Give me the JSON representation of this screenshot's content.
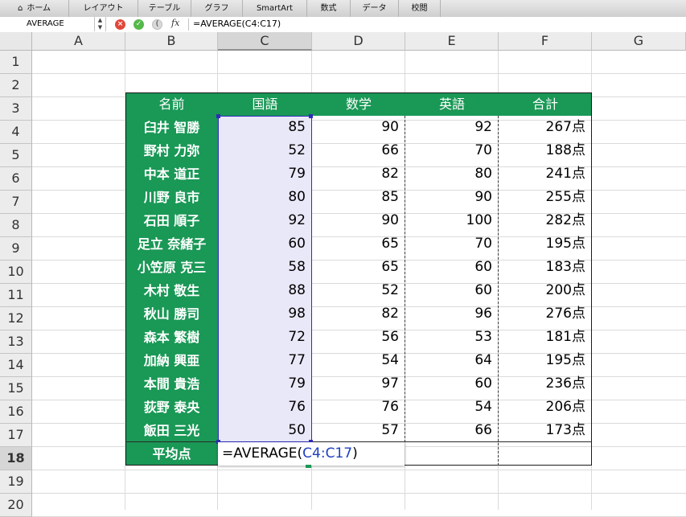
{
  "ribbon": {
    "tabs": [
      "ホーム",
      "レイアウト",
      "テーブル",
      "グラフ",
      "SmartArt",
      "数式",
      "データ",
      "校閲"
    ]
  },
  "formula_bar": {
    "name_box": "AVERAGE",
    "fx_label": "fx",
    "formula": "=AVERAGE(C4:C17)"
  },
  "sheet": {
    "columns": [
      "A",
      "B",
      "C",
      "D",
      "E",
      "F",
      "G"
    ],
    "selected_column": "C",
    "rows": [
      "1",
      "2",
      "3",
      "4",
      "5",
      "6",
      "7",
      "8",
      "9",
      "10",
      "11",
      "12",
      "13",
      "14",
      "15",
      "16",
      "17",
      "18",
      "19",
      "20"
    ],
    "selected_row": "18",
    "table_header": [
      "名前",
      "国語",
      "数学",
      "英語",
      "合計"
    ],
    "table_rows": [
      {
        "name": "臼井 智勝",
        "kokugo": "85",
        "sugaku": "90",
        "eigo": "92",
        "total": "267点"
      },
      {
        "name": "野村 力弥",
        "kokugo": "52",
        "sugaku": "66",
        "eigo": "70",
        "total": "188点"
      },
      {
        "name": "中本 道正",
        "kokugo": "79",
        "sugaku": "82",
        "eigo": "80",
        "total": "241点"
      },
      {
        "name": "川野 良市",
        "kokugo": "80",
        "sugaku": "85",
        "eigo": "90",
        "total": "255点"
      },
      {
        "name": "石田 順子",
        "kokugo": "92",
        "sugaku": "90",
        "eigo": "100",
        "total": "282点"
      },
      {
        "name": "足立 奈緒子",
        "kokugo": "60",
        "sugaku": "65",
        "eigo": "70",
        "total": "195点"
      },
      {
        "name": "小笠原 克三",
        "kokugo": "58",
        "sugaku": "65",
        "eigo": "60",
        "total": "183点"
      },
      {
        "name": "木村 敬生",
        "kokugo": "88",
        "sugaku": "52",
        "eigo": "60",
        "total": "200点"
      },
      {
        "name": "秋山 勝司",
        "kokugo": "98",
        "sugaku": "82",
        "eigo": "96",
        "total": "276点"
      },
      {
        "name": "森本 繁樹",
        "kokugo": "72",
        "sugaku": "56",
        "eigo": "53",
        "total": "181点"
      },
      {
        "name": "加納 興亜",
        "kokugo": "77",
        "sugaku": "54",
        "eigo": "64",
        "total": "195点"
      },
      {
        "name": "本間 貴浩",
        "kokugo": "79",
        "sugaku": "97",
        "eigo": "60",
        "total": "236点"
      },
      {
        "name": "荻野 泰央",
        "kokugo": "76",
        "sugaku": "76",
        "eigo": "54",
        "total": "206点"
      },
      {
        "name": "飯田 三光",
        "kokugo": "50",
        "sugaku": "57",
        "eigo": "66",
        "total": "173点"
      }
    ],
    "average_label": "平均点",
    "editing": {
      "prefix": "=AVERAGE(",
      "range": "C4:C17",
      "suffix": ")"
    }
  },
  "colors": {
    "header_green": "#1a9856",
    "selection_fill": "#e9e8f8",
    "selection_border": "#2d2db8",
    "reference_blue": "#1f3fbf"
  }
}
